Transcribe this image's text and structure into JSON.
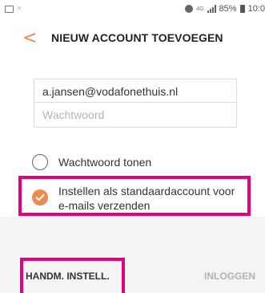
{
  "status_bar": {
    "network": "4G",
    "battery": "85%",
    "time": "10:0",
    "icons": [
      "image-icon",
      "mini-icon",
      "alarm-icon",
      "network-icon",
      "signal-icon",
      "battery-icon"
    ]
  },
  "header": {
    "back_icon": "chevron-left-icon",
    "title": "NIEUW ACCOUNT TOEVOEGEN"
  },
  "form": {
    "email_value": "a.jansen@vodafonethuis.nl",
    "password_placeholder": "Wachtwoord",
    "show_password_label": "Wachtwoord tonen",
    "default_account_label": "Instellen als standaardaccount voor e-mails verzenden",
    "default_account_checked": true
  },
  "footer": {
    "manual_label": "HANDM. INSTELL.",
    "login_label": "INLOGGEN"
  },
  "colors": {
    "accent": "#ee8a4e",
    "highlight": "#e4007e",
    "disabled_text": "#b3b3b3"
  }
}
